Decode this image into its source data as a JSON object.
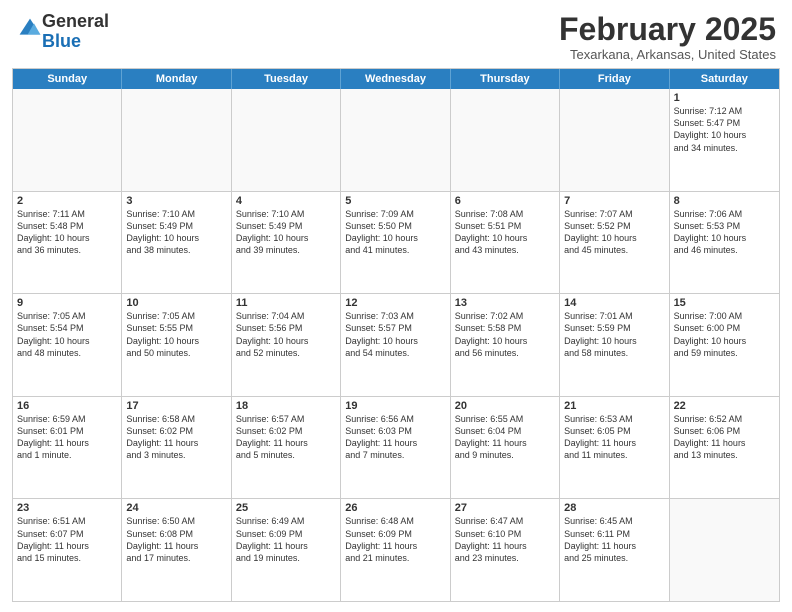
{
  "header": {
    "logo_general": "General",
    "logo_blue": "Blue",
    "month": "February 2025",
    "location": "Texarkana, Arkansas, United States"
  },
  "day_headers": [
    "Sunday",
    "Monday",
    "Tuesday",
    "Wednesday",
    "Thursday",
    "Friday",
    "Saturday"
  ],
  "weeks": [
    [
      {
        "day": "",
        "empty": true,
        "info": ""
      },
      {
        "day": "",
        "empty": true,
        "info": ""
      },
      {
        "day": "",
        "empty": true,
        "info": ""
      },
      {
        "day": "",
        "empty": true,
        "info": ""
      },
      {
        "day": "",
        "empty": true,
        "info": ""
      },
      {
        "day": "",
        "empty": true,
        "info": ""
      },
      {
        "day": "1",
        "empty": false,
        "info": "Sunrise: 7:12 AM\nSunset: 5:47 PM\nDaylight: 10 hours\nand 34 minutes."
      }
    ],
    [
      {
        "day": "2",
        "empty": false,
        "info": "Sunrise: 7:11 AM\nSunset: 5:48 PM\nDaylight: 10 hours\nand 36 minutes."
      },
      {
        "day": "3",
        "empty": false,
        "info": "Sunrise: 7:10 AM\nSunset: 5:49 PM\nDaylight: 10 hours\nand 38 minutes."
      },
      {
        "day": "4",
        "empty": false,
        "info": "Sunrise: 7:10 AM\nSunset: 5:49 PM\nDaylight: 10 hours\nand 39 minutes."
      },
      {
        "day": "5",
        "empty": false,
        "info": "Sunrise: 7:09 AM\nSunset: 5:50 PM\nDaylight: 10 hours\nand 41 minutes."
      },
      {
        "day": "6",
        "empty": false,
        "info": "Sunrise: 7:08 AM\nSunset: 5:51 PM\nDaylight: 10 hours\nand 43 minutes."
      },
      {
        "day": "7",
        "empty": false,
        "info": "Sunrise: 7:07 AM\nSunset: 5:52 PM\nDaylight: 10 hours\nand 45 minutes."
      },
      {
        "day": "8",
        "empty": false,
        "info": "Sunrise: 7:06 AM\nSunset: 5:53 PM\nDaylight: 10 hours\nand 46 minutes."
      }
    ],
    [
      {
        "day": "9",
        "empty": false,
        "info": "Sunrise: 7:05 AM\nSunset: 5:54 PM\nDaylight: 10 hours\nand 48 minutes."
      },
      {
        "day": "10",
        "empty": false,
        "info": "Sunrise: 7:05 AM\nSunset: 5:55 PM\nDaylight: 10 hours\nand 50 minutes."
      },
      {
        "day": "11",
        "empty": false,
        "info": "Sunrise: 7:04 AM\nSunset: 5:56 PM\nDaylight: 10 hours\nand 52 minutes."
      },
      {
        "day": "12",
        "empty": false,
        "info": "Sunrise: 7:03 AM\nSunset: 5:57 PM\nDaylight: 10 hours\nand 54 minutes."
      },
      {
        "day": "13",
        "empty": false,
        "info": "Sunrise: 7:02 AM\nSunset: 5:58 PM\nDaylight: 10 hours\nand 56 minutes."
      },
      {
        "day": "14",
        "empty": false,
        "info": "Sunrise: 7:01 AM\nSunset: 5:59 PM\nDaylight: 10 hours\nand 58 minutes."
      },
      {
        "day": "15",
        "empty": false,
        "info": "Sunrise: 7:00 AM\nSunset: 6:00 PM\nDaylight: 10 hours\nand 59 minutes."
      }
    ],
    [
      {
        "day": "16",
        "empty": false,
        "info": "Sunrise: 6:59 AM\nSunset: 6:01 PM\nDaylight: 11 hours\nand 1 minute."
      },
      {
        "day": "17",
        "empty": false,
        "info": "Sunrise: 6:58 AM\nSunset: 6:02 PM\nDaylight: 11 hours\nand 3 minutes."
      },
      {
        "day": "18",
        "empty": false,
        "info": "Sunrise: 6:57 AM\nSunset: 6:02 PM\nDaylight: 11 hours\nand 5 minutes."
      },
      {
        "day": "19",
        "empty": false,
        "info": "Sunrise: 6:56 AM\nSunset: 6:03 PM\nDaylight: 11 hours\nand 7 minutes."
      },
      {
        "day": "20",
        "empty": false,
        "info": "Sunrise: 6:55 AM\nSunset: 6:04 PM\nDaylight: 11 hours\nand 9 minutes."
      },
      {
        "day": "21",
        "empty": false,
        "info": "Sunrise: 6:53 AM\nSunset: 6:05 PM\nDaylight: 11 hours\nand 11 minutes."
      },
      {
        "day": "22",
        "empty": false,
        "info": "Sunrise: 6:52 AM\nSunset: 6:06 PM\nDaylight: 11 hours\nand 13 minutes."
      }
    ],
    [
      {
        "day": "23",
        "empty": false,
        "info": "Sunrise: 6:51 AM\nSunset: 6:07 PM\nDaylight: 11 hours\nand 15 minutes."
      },
      {
        "day": "24",
        "empty": false,
        "info": "Sunrise: 6:50 AM\nSunset: 6:08 PM\nDaylight: 11 hours\nand 17 minutes."
      },
      {
        "day": "25",
        "empty": false,
        "info": "Sunrise: 6:49 AM\nSunset: 6:09 PM\nDaylight: 11 hours\nand 19 minutes."
      },
      {
        "day": "26",
        "empty": false,
        "info": "Sunrise: 6:48 AM\nSunset: 6:09 PM\nDaylight: 11 hours\nand 21 minutes."
      },
      {
        "day": "27",
        "empty": false,
        "info": "Sunrise: 6:47 AM\nSunset: 6:10 PM\nDaylight: 11 hours\nand 23 minutes."
      },
      {
        "day": "28",
        "empty": false,
        "info": "Sunrise: 6:45 AM\nSunset: 6:11 PM\nDaylight: 11 hours\nand 25 minutes."
      },
      {
        "day": "",
        "empty": true,
        "info": ""
      }
    ]
  ]
}
